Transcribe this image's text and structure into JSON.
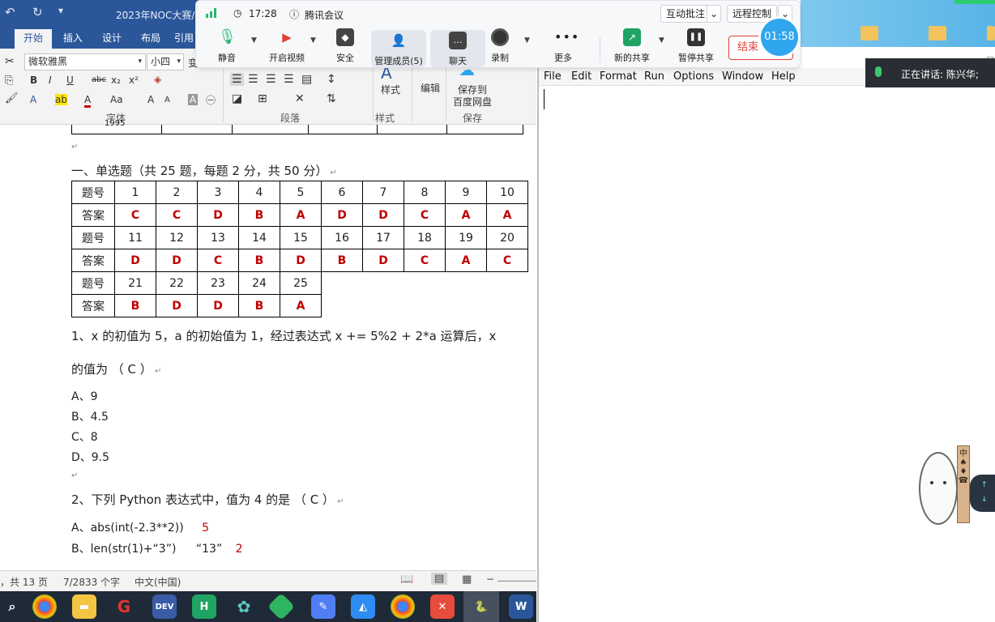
{
  "word": {
    "title": "2023年NOC大赛/",
    "tabs": [
      "开始",
      "插入",
      "设计",
      "布局",
      "引用"
    ],
    "active_tab": "开始",
    "font_name": "微软雅黑",
    "font_size": "小四",
    "font_size_extra": "变",
    "group_labels": {
      "font": "字体",
      "paragraph": "段落",
      "styles": "样式",
      "save": "保存"
    },
    "ribbon_buttons": {
      "styles": "样式",
      "edit": "编辑",
      "save_line1": "保存到",
      "save_line2": "百度网盘"
    },
    "font_buttons": [
      "B",
      "I",
      "U",
      "abc",
      "x₂",
      "x²"
    ],
    "font_buttons_row2": [
      "A",
      "ab",
      "A",
      "Aa",
      "A",
      "A",
      "A",
      "㊀"
    ]
  },
  "doc": {
    "section_heading": "一、单选题（共 25 题，每题 2 分，共 50 分）",
    "table": {
      "row_label_q": "题号",
      "row_label_a": "答案",
      "rows": [
        {
          "nums": [
            "1",
            "2",
            "3",
            "4",
            "5",
            "6",
            "7",
            "8",
            "9",
            "10"
          ],
          "answers": [
            "C",
            "C",
            "D",
            "B",
            "A",
            "D",
            "D",
            "C",
            "A",
            "A"
          ]
        },
        {
          "nums": [
            "11",
            "12",
            "13",
            "14",
            "15",
            "16",
            "17",
            "18",
            "19",
            "20"
          ],
          "answers": [
            "D",
            "D",
            "C",
            "B",
            "D",
            "B",
            "D",
            "C",
            "A",
            "C"
          ]
        },
        {
          "nums": [
            "21",
            "22",
            "23",
            "24",
            "25"
          ],
          "answers": [
            "B",
            "D",
            "D",
            "B",
            "A"
          ]
        }
      ]
    },
    "q1_line1": "1、x 的初值为 5，a 的初始值为 1，经过表达式 x += 5%2 + 2*a 运算后，x",
    "q1_line2": "的值为 （ C ）",
    "q1_options": [
      "A、9",
      "B、4.5",
      "C、8",
      "D、9.5"
    ],
    "q2_line": "2、下列 Python 表达式中，值为 4 的是 （ C ）",
    "q2_optA": "A、abs(int(-2.3**2))",
    "q2_optA_note": "5",
    "q2_optB": "B、len(str(1)+“3”)",
    "q2_optB_mid": "“13”",
    "q2_optB_note": "2",
    "table_top_partial": "1995"
  },
  "statusbar": {
    "pages": "，共 13 页",
    "words": "7/2833 个字",
    "lang": "中文(中国)"
  },
  "meeting": {
    "time": "17:28",
    "app_name": "腾讯会议",
    "btn_annotate": "互动批注",
    "btn_remote": "远程控制",
    "tools": [
      "静音",
      "开启视频",
      "安全",
      "管理成员(5)",
      "聊天",
      "录制",
      "更多",
      "新的共享",
      "暂停共享"
    ],
    "end": "结束",
    "duration": "01:58"
  },
  "speaking": "正在讲话: 陈兴华;",
  "idle": {
    "menu": [
      "File",
      "Edit",
      "Format",
      "Run",
      "Options",
      "Window",
      "Help"
    ]
  },
  "mascot": {
    "stamp_text": "中"
  },
  "colors": {
    "word_blue": "#2b579a",
    "answer_red": "#c00000",
    "meeting_blue": "#2fa6ee",
    "end_red": "#e0433a"
  }
}
